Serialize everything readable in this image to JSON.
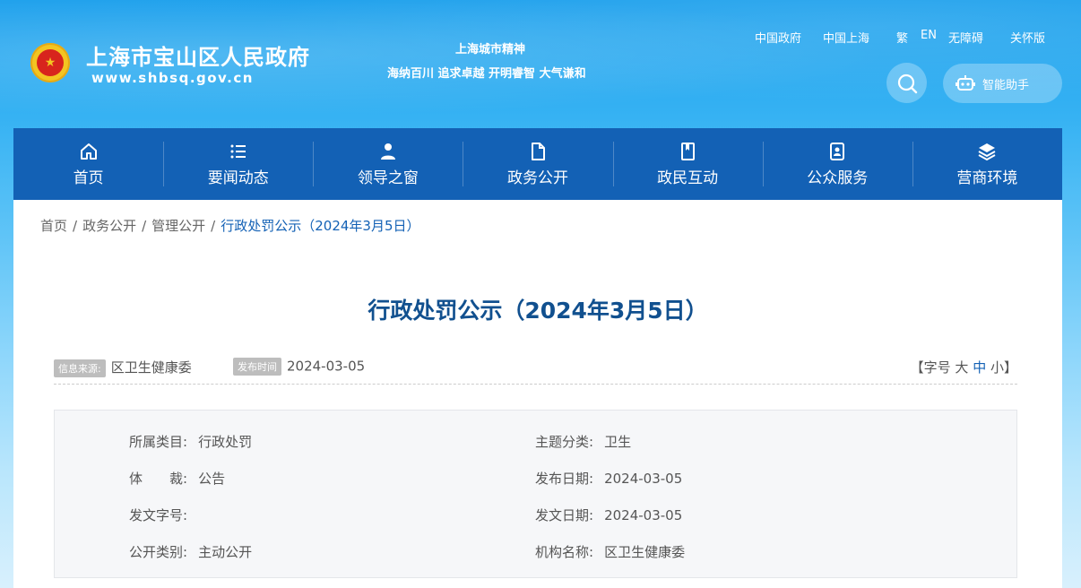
{
  "header": {
    "site_name": "上海市宝山区人民政府",
    "site_url": "www.shbsq.gov.cn",
    "spirit_title": "上海城市精神",
    "spirit_text": "海纳百川 追求卓越 开明睿智 大气谦和",
    "top_links": [
      "中国政府",
      "中国上海",
      "繁",
      "EN",
      "无障碍",
      "关怀版"
    ],
    "assistant_label": "智能助手"
  },
  "nav": {
    "items": [
      {
        "label": "首页",
        "icon": "home-icon"
      },
      {
        "label": "要闻动态",
        "icon": "list-icon"
      },
      {
        "label": "领导之窗",
        "icon": "person-icon"
      },
      {
        "label": "政务公开",
        "icon": "document-icon"
      },
      {
        "label": "政民互动",
        "icon": "book-icon"
      },
      {
        "label": "公众服务",
        "icon": "badge-icon"
      },
      {
        "label": "营商环境",
        "icon": "layers-icon"
      }
    ]
  },
  "breadcrumb": [
    "首页",
    "政务公开",
    "管理公开",
    "行政处罚公示（2024年3月5日）"
  ],
  "article": {
    "title": "行政处罚公示（2024年3月5日）",
    "source_tag": "信息来源:",
    "source": "区卫生健康委",
    "date_tag": "发布时间",
    "date": "2024-03-05",
    "fontsize": {
      "open": "【字号",
      "large": "大",
      "medium": "中",
      "small": "小】"
    }
  },
  "info": {
    "category_label": "所属类目:",
    "category": "行政处罚",
    "topic_label": "主题分类:",
    "topic": "卫生",
    "genre_label": "体　　裁:",
    "genre": "公告",
    "publish_label": "发布日期:",
    "publish": "2024-03-05",
    "docno_label": "发文字号:",
    "docno": "",
    "issue_label": "发文日期:",
    "issue": "2024-03-05",
    "open_label": "公开类别:",
    "open": "主动公开",
    "org_label": "机构名称:",
    "org": "区卫生健康委"
  }
}
